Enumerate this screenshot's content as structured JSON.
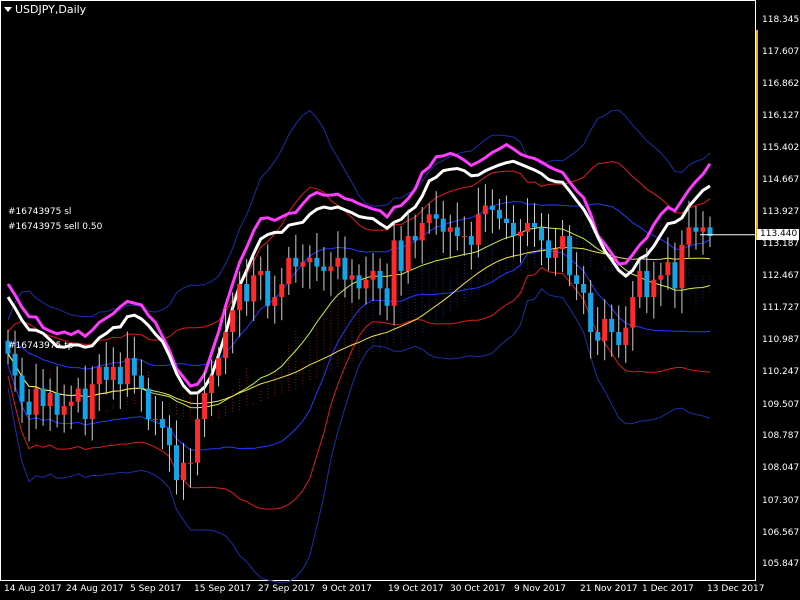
{
  "window": {
    "title": "USDJPY,Daily"
  },
  "labels": {
    "sl": "#16743975 sl",
    "sell": "#16743975 sell 0.50",
    "tp": "#16743975 tp"
  },
  "chart_data": {
    "type": "candlestick",
    "symbol": "USDJPY",
    "timeframe": "Daily",
    "ylim": [
      105.6,
      118.45
    ],
    "grid": false,
    "current_price": "113.440",
    "y_ticks": [
      "118.345",
      "117.607",
      "116.862",
      "116.127",
      "115.402",
      "114.667",
      "113.927",
      "113.187",
      "112.467",
      "111.727",
      "110.987",
      "110.247",
      "109.507",
      "108.787",
      "108.047",
      "107.307",
      "106.567",
      "105.847"
    ],
    "x_ticks": [
      "14 Aug 2017",
      "24 Aug 2017",
      "5 Sep 2017",
      "15 Sep 2017",
      "27 Sep 2017",
      "9 Oct 2017",
      "19 Oct 2017",
      "30 Oct 2017",
      "9 Nov 2017",
      "21 Nov 2017",
      "1 Dec 2017",
      "13 Dec 2017"
    ],
    "series": [
      {
        "color": "#ff2a2a",
        "closes": [
          110.7,
          110.2,
          109.6,
          109.3,
          109.9,
          109.5,
          109.8,
          109.3,
          109.5,
          109.6,
          109.9,
          109.2,
          110.0,
          110.4,
          110.1,
          110.4,
          110.0,
          110.6,
          110.2,
          109.9,
          109.2,
          109.2,
          109.0,
          108.6,
          107.8,
          108.2,
          108.2,
          109.2,
          109.8,
          110.2,
          110.6,
          111.2,
          111.7,
          112.3,
          111.9,
          112.5,
          112.6,
          111.8,
          112.0,
          112.3,
          112.9,
          112.7,
          112.8,
          112.9,
          112.7,
          112.6,
          112.7,
          112.9,
          112.4,
          112.5,
          112.2,
          112.4,
          112.6,
          112.2,
          111.8,
          113.3,
          112.6,
          113.4,
          113.3,
          113.7,
          113.9,
          113.8,
          113.5,
          113.6,
          113.4,
          113.4,
          113.2,
          113.9,
          114.1,
          114.0,
          113.8,
          113.7,
          113.4,
          113.5,
          113.7,
          113.6,
          113.3,
          112.9,
          113.1,
          113.4,
          112.5,
          112.3,
          112.1,
          111.2,
          111.0,
          111.5,
          111.2,
          110.9,
          111.3,
          112.0,
          112.6,
          112.0,
          112.4,
          112.5,
          112.8,
          112.2,
          113.2,
          113.6,
          113.5,
          113.6,
          113.4
        ]
      },
      {
        "color": "#00a0e0",
        "closes": []
      }
    ]
  }
}
